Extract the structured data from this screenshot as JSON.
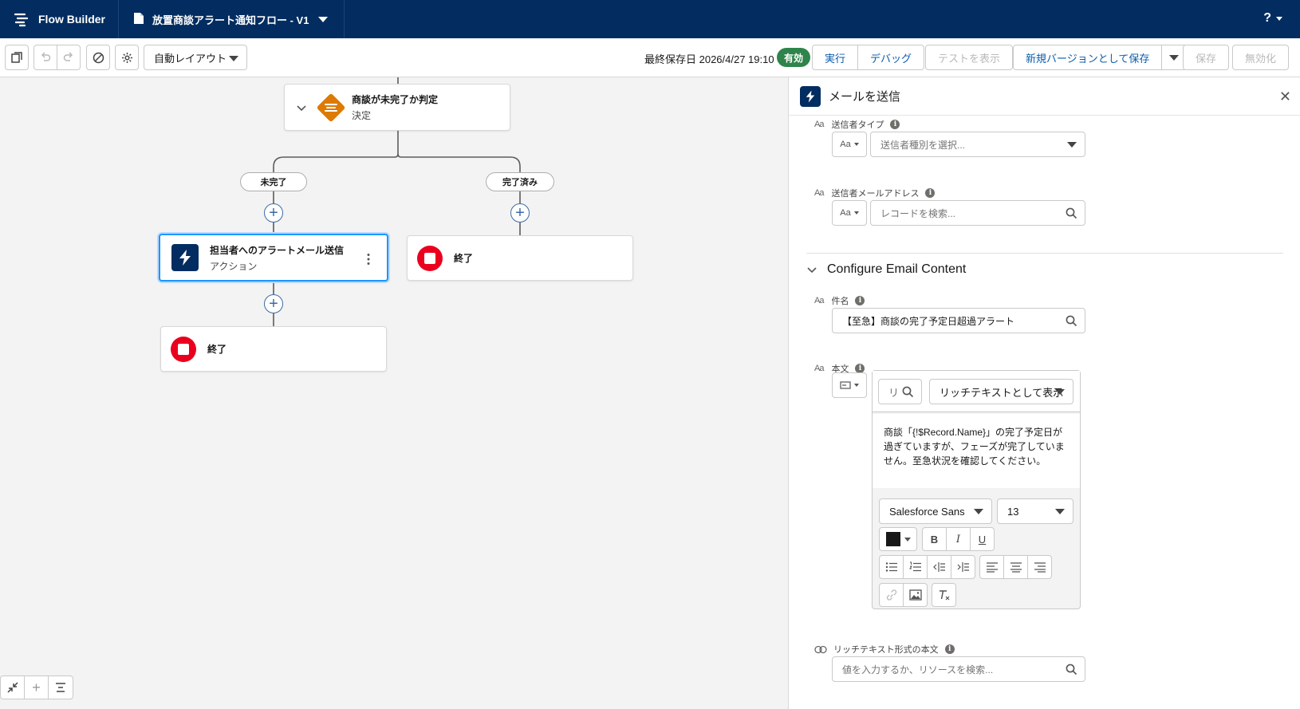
{
  "header": {
    "app_name": "Flow Builder",
    "flow_title": "放置商談アラート通知フロー - V1",
    "help_label": "?"
  },
  "toolbar": {
    "layout_select": "自動レイアウト",
    "last_saved": "最終保存日 2026/4/27 19:10",
    "status_badge": "有効",
    "run_label": "実行",
    "debug_label": "デバッグ",
    "view_tests_label": "テストを表示",
    "save_as_new_version_label": "新規バージョンとして保存",
    "save_label": "保存",
    "deactivate_label": "無効化"
  },
  "canvas": {
    "decision_node": {
      "title": "商談が未完了か判定",
      "subtitle": "決定"
    },
    "branch_left": "未完了",
    "branch_right": "完了済み",
    "action_node": {
      "title": "担当者へのアラートメール送信",
      "subtitle": "アクション"
    },
    "end_left": "終了",
    "end_right": "終了"
  },
  "panel": {
    "title": "メールを送信",
    "sender_type": {
      "label": "送信者タイプ",
      "placeholder": "送信者種別を選択..."
    },
    "sender_email": {
      "label": "送信者メールアドレス",
      "placeholder": "レコードを検索..."
    },
    "section_title": "Configure Email Content",
    "subject": {
      "label": "件名",
      "value": "【至急】商談の完了予定日超過アラート"
    },
    "body": {
      "label": "本文",
      "resource_search_text": "リ",
      "display_mode": "リッチテキストとして表示",
      "content": "商談「{!$Record.Name}」の完了予定日が過ぎていますが、フェーズが完了していません。至急状況を確認してください。",
      "font_family": "Salesforce Sans",
      "font_size": "13",
      "bold": "B",
      "italic": "I",
      "underline": "U"
    },
    "rich_text_body": {
      "label": "リッチテキスト形式の本文",
      "placeholder": "値を入力するか、リソースを検索..."
    }
  },
  "colors": {
    "header_bg": "#032d60",
    "active_badge": "#2e844a",
    "decision_orange": "#dd7a01",
    "end_red": "#ea001e",
    "link_blue": "#0b5cab",
    "selection_blue": "#1b96ff"
  }
}
